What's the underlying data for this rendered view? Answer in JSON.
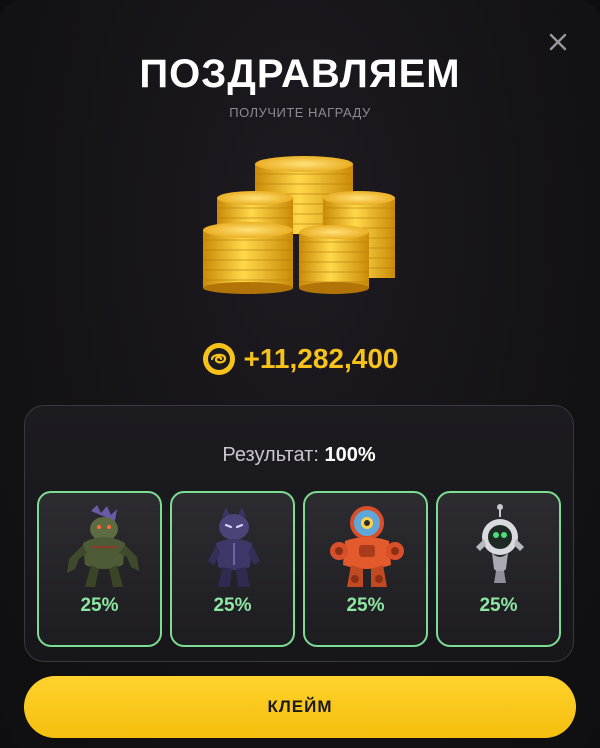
{
  "modal": {
    "title": "ПОЗДРАВЛЯЕМ",
    "subtitle": "ПОЛУЧИТЕ НАГРАДУ",
    "close_icon": "close-icon"
  },
  "reward": {
    "icon": "coin-icon",
    "amount": "+11,282,400",
    "color": "#f7c21a"
  },
  "result": {
    "label": "Результат:",
    "value": "100%"
  },
  "cards": [
    {
      "name": "green-beast",
      "percent": "25%"
    },
    {
      "name": "purple-panther",
      "percent": "25%"
    },
    {
      "name": "orange-robot",
      "percent": "25%"
    },
    {
      "name": "drone-bot",
      "percent": "25%"
    }
  ],
  "claim_button": {
    "label": "КЛЕЙМ",
    "color": "#f5bf0c"
  }
}
